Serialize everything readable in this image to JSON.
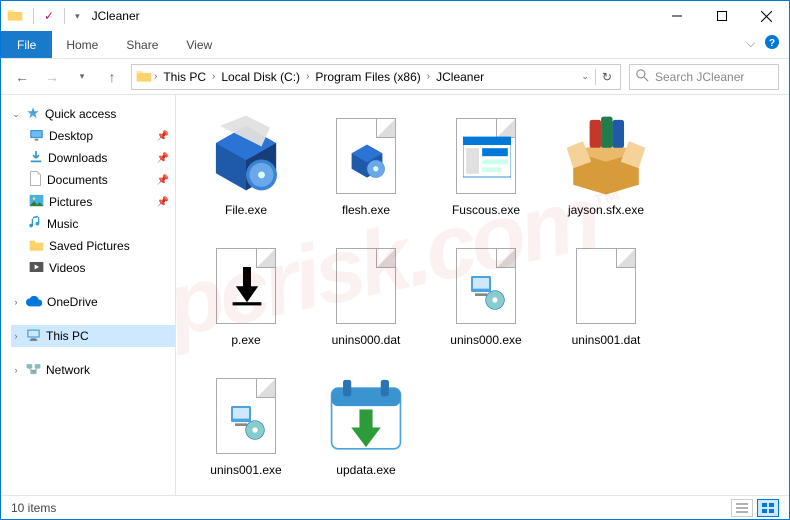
{
  "window": {
    "title": "JCleaner"
  },
  "ribbon": {
    "file": "File",
    "tabs": [
      "Home",
      "Share",
      "View"
    ]
  },
  "breadcrumb": [
    "This PC",
    "Local Disk (C:)",
    "Program Files (x86)",
    "JCleaner"
  ],
  "search": {
    "placeholder": "Search JCleaner"
  },
  "sidebar": {
    "quick_access": {
      "label": "Quick access",
      "items": [
        {
          "label": "Desktop",
          "pinned": true
        },
        {
          "label": "Downloads",
          "pinned": true
        },
        {
          "label": "Documents",
          "pinned": true
        },
        {
          "label": "Pictures",
          "pinned": true
        },
        {
          "label": "Music",
          "pinned": false
        },
        {
          "label": "Saved Pictures",
          "pinned": false
        },
        {
          "label": "Videos",
          "pinned": false
        }
      ]
    },
    "onedrive": {
      "label": "OneDrive"
    },
    "this_pc": {
      "label": "This PC"
    },
    "network": {
      "label": "Network"
    }
  },
  "files": [
    {
      "name": "File.exe",
      "icon": "installer-box"
    },
    {
      "name": "flesh.exe",
      "icon": "installer-small"
    },
    {
      "name": "Fuscous.exe",
      "icon": "app-window"
    },
    {
      "name": "jayson.sfx.exe",
      "icon": "archive-box"
    },
    {
      "name": "p.exe",
      "icon": "download-arrow"
    },
    {
      "name": "unins000.dat",
      "icon": "blank"
    },
    {
      "name": "unins000.exe",
      "icon": "uninstaller"
    },
    {
      "name": "unins001.dat",
      "icon": "blank"
    },
    {
      "name": "unins001.exe",
      "icon": "uninstaller"
    },
    {
      "name": "updata.exe",
      "icon": "calendar-download"
    }
  ],
  "status": {
    "count_label": "10 items"
  },
  "watermark": "pcrisk.com"
}
